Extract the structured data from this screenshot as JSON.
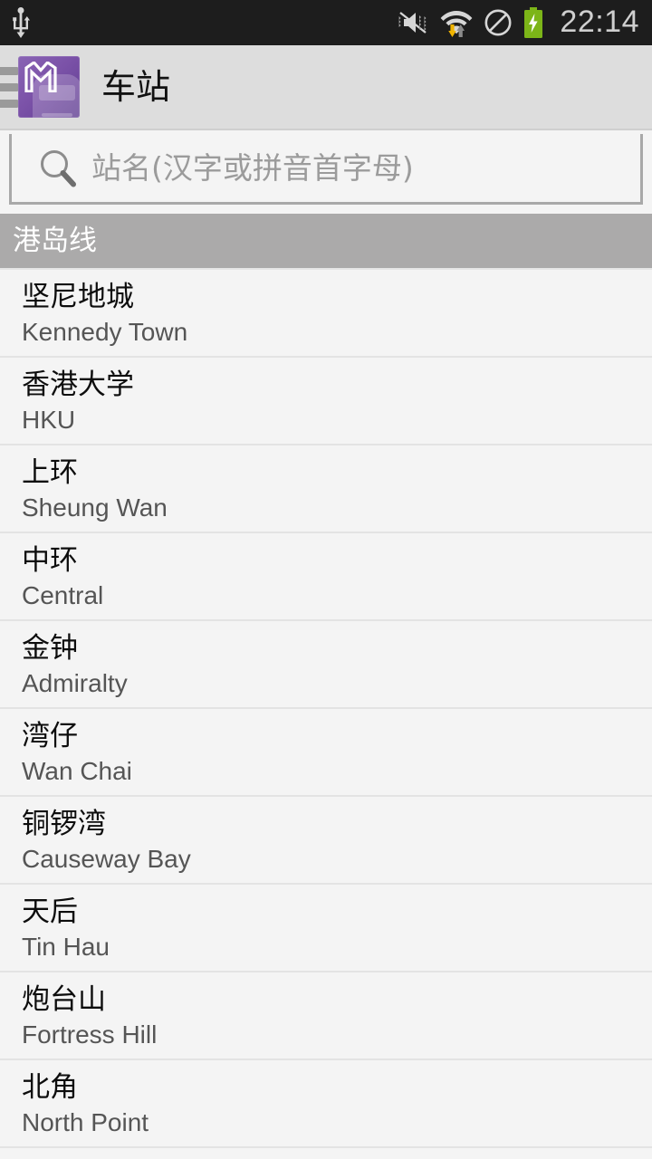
{
  "status_bar": {
    "time": "22:14",
    "icons": [
      {
        "name": "usb-icon",
        "position": "left"
      },
      {
        "name": "volume-mute-vibrate-icon",
        "position": "right"
      },
      {
        "name": "wifi-signal-icon",
        "position": "right"
      },
      {
        "name": "do-not-disturb-icon",
        "position": "right"
      },
      {
        "name": "battery-charging-icon",
        "position": "right"
      }
    ],
    "background_color": "#1d1d1d",
    "text_color": "#cfcfcf",
    "battery_color": "#7cb518",
    "download_arrow_color": "#f0b400"
  },
  "action_bar": {
    "title": "车站",
    "app_icon_name": "mtr-app-icon",
    "drawer_icon_name": "navigation-drawer-icon",
    "background_color": "#dddddd",
    "icon_color": "#7b52a8"
  },
  "search": {
    "value": "",
    "placeholder": "站名(汉字或拼音首字母)",
    "icon_name": "search-icon"
  },
  "section": {
    "header": "港岛线",
    "header_background": "#abaaaa"
  },
  "stations": [
    {
      "cn": "坚尼地城",
      "en": "Kennedy Town"
    },
    {
      "cn": "香港大学",
      "en": "HKU"
    },
    {
      "cn": "上环",
      "en": "Sheung Wan"
    },
    {
      "cn": "中环",
      "en": "Central"
    },
    {
      "cn": "金钟",
      "en": "Admiralty"
    },
    {
      "cn": "湾仔",
      "en": "Wan Chai"
    },
    {
      "cn": "铜锣湾",
      "en": "Causeway Bay"
    },
    {
      "cn": "天后",
      "en": "Tin Hau"
    },
    {
      "cn": "炮台山",
      "en": "Fortress Hill"
    },
    {
      "cn": "北角",
      "en": "North Point"
    }
  ]
}
